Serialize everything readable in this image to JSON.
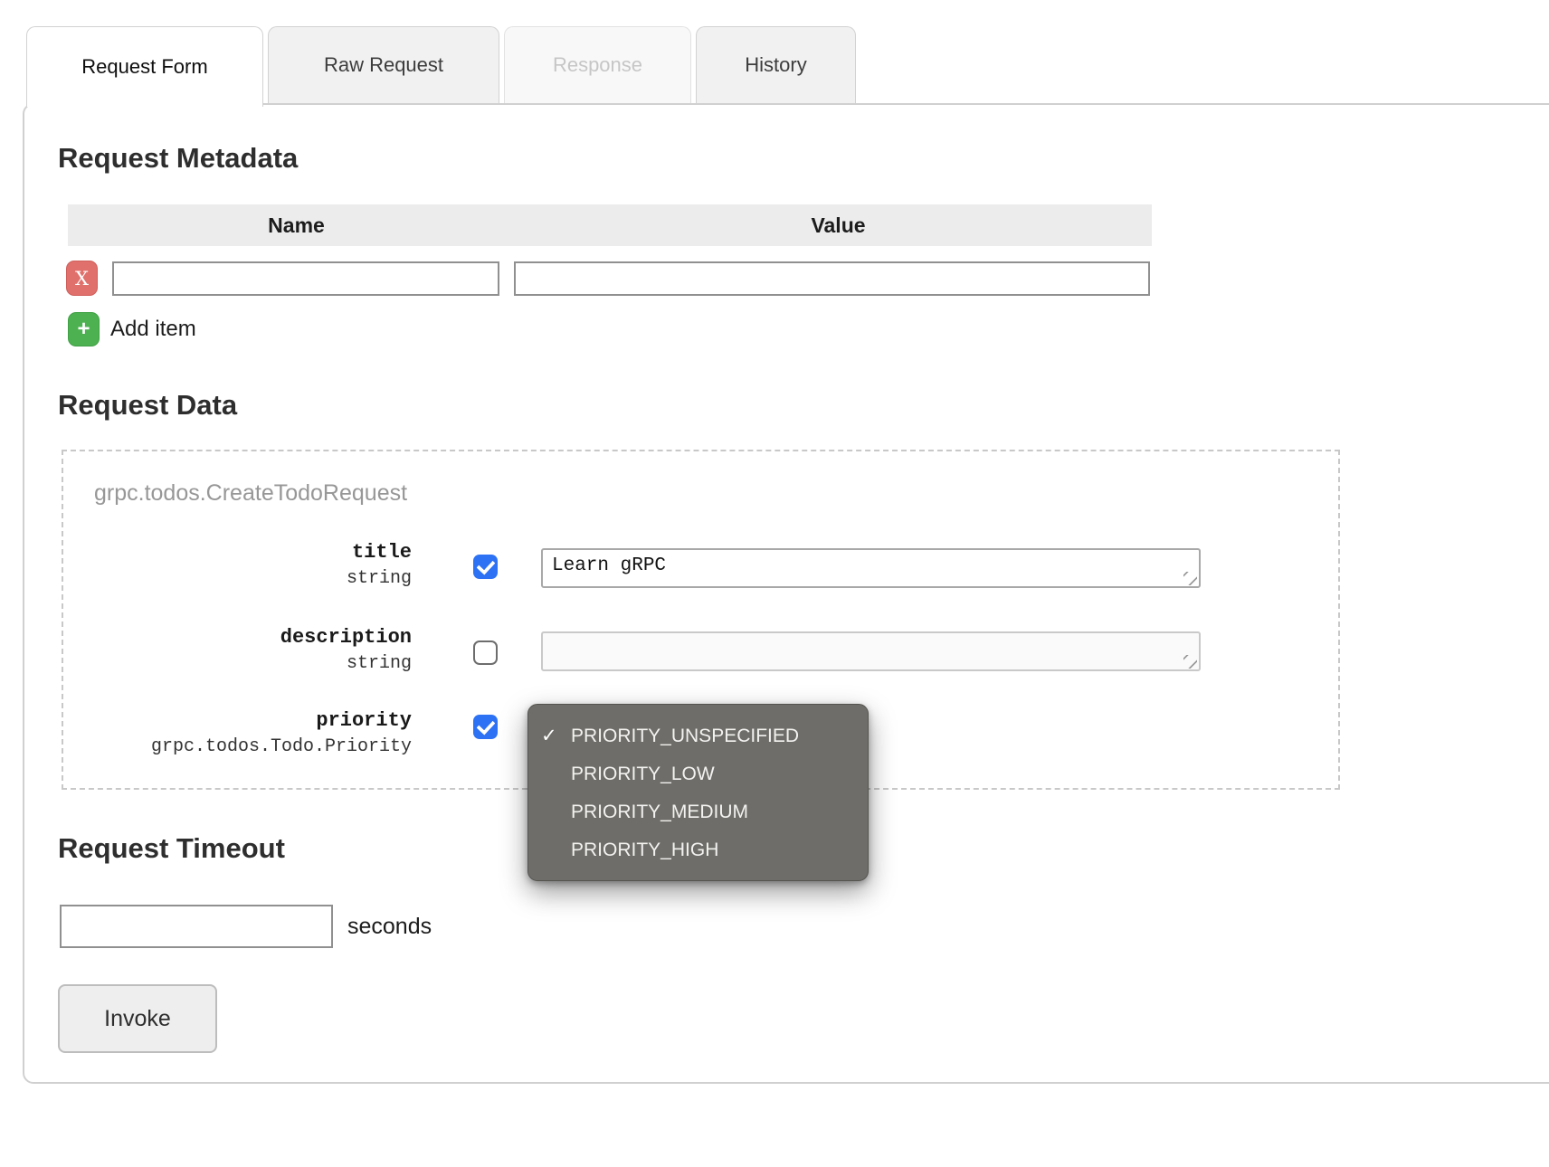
{
  "tabs": [
    {
      "label": "Request Form",
      "state": "active"
    },
    {
      "label": "Raw Request",
      "state": "normal"
    },
    {
      "label": "Response",
      "state": "disabled"
    },
    {
      "label": "History",
      "state": "normal"
    }
  ],
  "metadata": {
    "heading": "Request Metadata",
    "columns": {
      "name": "Name",
      "value": "Value"
    },
    "row": {
      "name": "",
      "value": ""
    },
    "remove_button": "X",
    "add_button": "+",
    "add_label": "Add item"
  },
  "request_data": {
    "heading": "Request Data",
    "message_type": "grpc.todos.CreateTodoRequest",
    "fields": [
      {
        "name": "title",
        "type": "string",
        "checked": true,
        "value": "Learn gRPC"
      },
      {
        "name": "description",
        "type": "string",
        "checked": false,
        "value": ""
      },
      {
        "name": "priority",
        "type": "grpc.todos.Todo.Priority",
        "checked": true
      }
    ]
  },
  "priority_menu": {
    "selected_mark": "✓",
    "selected": "PRIORITY_UNSPECIFIED",
    "options": [
      "PRIORITY_UNSPECIFIED",
      "PRIORITY_LOW",
      "PRIORITY_MEDIUM",
      "PRIORITY_HIGH"
    ]
  },
  "timeout": {
    "heading": "Request Timeout",
    "value": "",
    "unit": "seconds"
  },
  "invoke": {
    "label": "Invoke"
  },
  "colors": {
    "accent_blue": "#2d72f5",
    "remove_red": "#e0706c",
    "add_green": "#4db151",
    "menu_bg": "#6e6d69",
    "tab_inactive_bg": "#f1f1f1",
    "table_header_bg": "#ececec"
  }
}
